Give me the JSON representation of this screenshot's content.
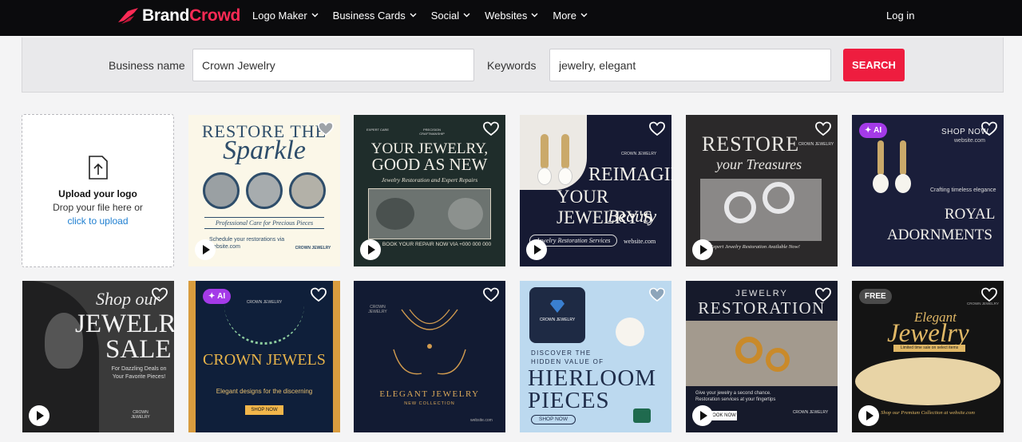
{
  "brand": {
    "part1": "Brand",
    "part2": "Crowd",
    "accent": "#ff2a55"
  },
  "nav": {
    "items": [
      {
        "label": "Logo Maker"
      },
      {
        "label": "Business Cards"
      },
      {
        "label": "Social"
      },
      {
        "label": "Websites"
      },
      {
        "label": "More"
      }
    ],
    "login": "Log in"
  },
  "search": {
    "business_label": "Business name",
    "business_value": "Crown Jewelry",
    "keywords_label": "Keywords",
    "keywords_value": "jewelry, elegant",
    "button": "SEARCH",
    "button_color": "#ee1d3f"
  },
  "upload": {
    "title": "Upload your logo",
    "text": "Drop your file here or",
    "link": "click to upload"
  },
  "designs": [
    {
      "id": "t1",
      "texts": [
        "RESTORE THE",
        "Sparkle",
        "Professional Care for Precious Pieces",
        "Schedule your restorations via website.com",
        "CROWN JEWELRY"
      ],
      "play": true
    },
    {
      "id": "t2",
      "texts": [
        "EXPERT CARE",
        "PRECISION CRAFTMANSHIP",
        "YOUR JEWELRY,",
        "GOOD AS NEW",
        "Jewelry Restoration and Expert Repairs",
        "BOOK YOUR REPAIR NOW VIA +000 000 000"
      ],
      "play": true
    },
    {
      "id": "t3",
      "texts": [
        "CROWN JEWELRY",
        "REIMAGINE",
        "YOUR JEWELRY'S",
        "Beauty",
        "Jewelry Restoration Services",
        "website.com"
      ],
      "play": true
    },
    {
      "id": "t4",
      "texts": [
        "RESTORE",
        "your Treasures",
        "CROWN JEWELRY",
        "Expert Jewelry Restoration Available Now!"
      ],
      "play": true
    },
    {
      "id": "t5",
      "badge": "AI",
      "texts": [
        "SHOP NOW",
        "website.com",
        "Crafting timeless elegance",
        "ROYAL",
        "ADORNMENTS"
      ]
    },
    {
      "id": "t6",
      "texts": [
        "Shop our",
        "JEWELRY",
        "SALE",
        "For Dazzling Deals on Your Favorite Pieces!",
        "CROWN JEWELRY"
      ],
      "play": true
    },
    {
      "id": "t7",
      "badge": "AI",
      "texts": [
        "CROWN JEWELRY",
        "CROWN JEWELS",
        "Elegant designs for the discerning",
        "SHOP NOW"
      ]
    },
    {
      "id": "t8",
      "texts": [
        "CROWN JEWELRY",
        "ELEGANT JEWELRY",
        "NEW COLLECTION",
        "website.com"
      ]
    },
    {
      "id": "t9",
      "texts": [
        "CROWN JEWELRY",
        "DISCOVER THE",
        "HIDDEN VALUE OF",
        "HIERLOOM",
        "PIECES",
        "SHOP NOW"
      ]
    },
    {
      "id": "t10",
      "texts": [
        "JEWELRY",
        "RESTORATION",
        "Give your jewelry a second chance.",
        "Restoration services at your fingertips",
        "CROWN JEWELRY",
        "BOOK NOW"
      ],
      "play": true
    },
    {
      "id": "t11",
      "badge": "FREE",
      "texts": [
        "Elegant",
        "Jewelry",
        "Limited time sale on select items",
        "Shop our Premium Collection at website.com",
        "CROWN JEWELRY"
      ],
      "play": true
    }
  ]
}
